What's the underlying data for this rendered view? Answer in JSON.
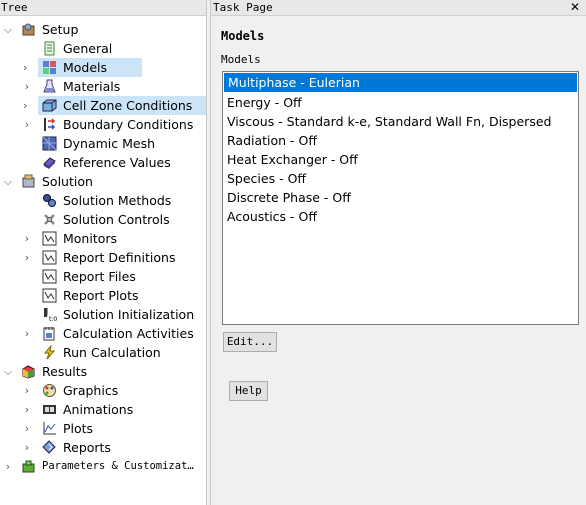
{
  "tree": {
    "header": "Tree",
    "items": [
      {
        "label": "Setup",
        "icon": "setup-icon",
        "chev": "expanded"
      },
      {
        "label": "General",
        "icon": "general-icon",
        "chev": "none"
      },
      {
        "label": "Models",
        "icon": "models-icon",
        "chev": "collapsed",
        "selected": true
      },
      {
        "label": "Materials",
        "icon": "materials-icon",
        "chev": "collapsed"
      },
      {
        "label": "Cell Zone Conditions",
        "icon": "cell-zone-icon",
        "chev": "collapsed",
        "hover": true
      },
      {
        "label": "Boundary Conditions",
        "icon": "boundary-icon",
        "chev": "collapsed"
      },
      {
        "label": "Dynamic Mesh",
        "icon": "dynamic-mesh-icon",
        "chev": "none"
      },
      {
        "label": "Reference Values",
        "icon": "reference-values-icon",
        "chev": "none"
      },
      {
        "label": "Solution",
        "icon": "solution-icon",
        "chev": "expanded"
      },
      {
        "label": "Solution Methods",
        "icon": "solution-methods-icon",
        "chev": "none"
      },
      {
        "label": "Solution Controls",
        "icon": "solution-controls-icon",
        "chev": "none"
      },
      {
        "label": "Monitors",
        "icon": "monitors-icon",
        "chev": "collapsed"
      },
      {
        "label": "Report Definitions",
        "icon": "report-definitions-icon",
        "chev": "collapsed"
      },
      {
        "label": "Report Files",
        "icon": "report-files-icon",
        "chev": "none"
      },
      {
        "label": "Report Plots",
        "icon": "report-plots-icon",
        "chev": "none"
      },
      {
        "label": "Solution Initialization",
        "icon": "solution-initialization-icon",
        "chev": "none"
      },
      {
        "label": "Calculation Activities",
        "icon": "calculation-activities-icon",
        "chev": "collapsed"
      },
      {
        "label": "Run Calculation",
        "icon": "run-calculation-icon",
        "chev": "none"
      },
      {
        "label": "Results",
        "icon": "results-icon",
        "chev": "expanded"
      },
      {
        "label": "Graphics",
        "icon": "graphics-icon",
        "chev": "collapsed"
      },
      {
        "label": "Animations",
        "icon": "animations-icon",
        "chev": "collapsed"
      },
      {
        "label": "Plots",
        "icon": "plots-icon",
        "chev": "collapsed"
      },
      {
        "label": "Reports",
        "icon": "reports-icon",
        "chev": "collapsed"
      },
      {
        "label": "Parameters & Customizat…",
        "icon": "parameters-icon",
        "chev": "collapsed"
      }
    ]
  },
  "task": {
    "header": "Task Page",
    "close": "✕",
    "title": "Models",
    "list_label": "Models",
    "models": [
      "Multiphase - Eulerian",
      "Energy - Off",
      "Viscous - Standard k-e, Standard Wall Fn, Dispersed",
      "Radiation - Off",
      "Heat Exchanger - Off",
      "Species - Off",
      "Discrete Phase - Off",
      "Acoustics - Off"
    ],
    "edit_label": "Edit...",
    "help_label": "Help"
  },
  "colors": {
    "selection": "#0078d7",
    "tree_highlight": "#cce4f7"
  }
}
